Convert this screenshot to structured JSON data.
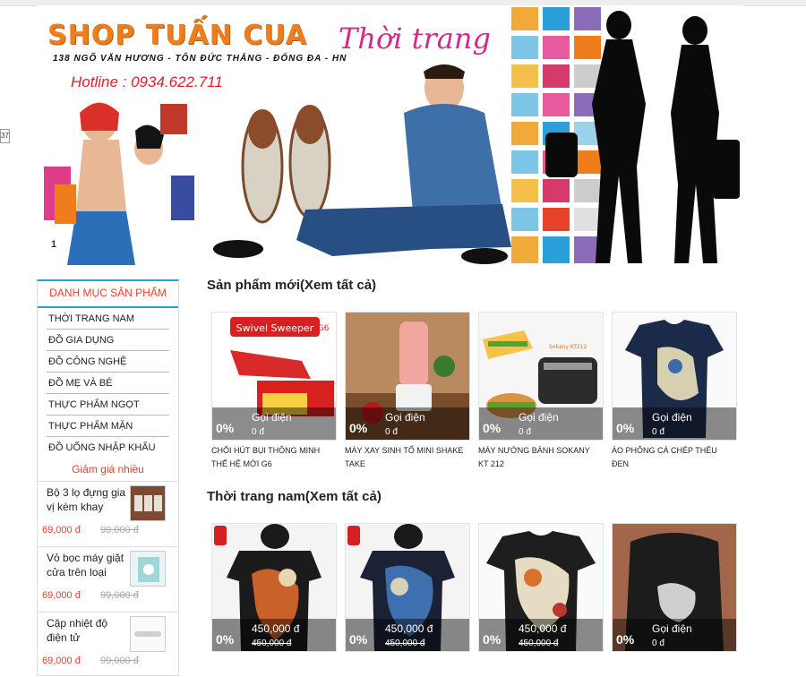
{
  "side_tag": "37",
  "banner": {
    "shop_name": "SHOP TUẤN CUA",
    "address": "138 NGÕ VĂN HƯƠNG - TÔN ĐỨC THẮNG - ĐỐNG ĐA - HN",
    "hotline": "Hotline : 0934.622.711",
    "script_text": "Thời trang",
    "slide_index": "1"
  },
  "sidebar": {
    "category_heading": "DANH MỤC SẢN PHẨM",
    "categories": [
      "THỜI TRANG NAM",
      "ĐỒ GIA DỤNG",
      "ĐỒ CÔNG NGHỆ",
      "ĐỒ MẸ VÀ BÉ",
      "THỰC PHẨM NGỌT",
      "THỰC PHẨM MẶN",
      "ĐỒ UỐNG NHẬP KHẨU"
    ],
    "promo_heading": "Giảm giá nhiều",
    "promos": [
      {
        "name": "Bộ 3 lọ đựng gia vị kèm khay",
        "price": "69,000 đ",
        "old_price": "99,000 đ"
      },
      {
        "name": "Vỏ bọc máy giặt cửa trên loại",
        "price": "69,000 đ",
        "old_price": "99,000 đ"
      },
      {
        "name": "Cặp nhiệt độ điện tử",
        "price": "69,000 đ",
        "old_price": "99,000 đ"
      }
    ]
  },
  "sections": [
    {
      "title": "Sản phẩm mới(Xem tất cả)",
      "products": [
        {
          "name": "CHỔI HÚT BỤI THÔNG MINH THẾ HỆ MỚI G6",
          "discount": "0%",
          "price": "Gọi điện",
          "old_price": "0 đ"
        },
        {
          "name": "MÁY XAY SINH TỐ MINI SHAKE TAKE",
          "discount": "0%",
          "price": "Gọi điện",
          "old_price": "0 đ"
        },
        {
          "name": "MÁY NƯỚNG BÁNH SOKANY KT 212",
          "discount": "0%",
          "price": "Gọi điện",
          "old_price": "0 đ"
        },
        {
          "name": "ÁO PHÔNG CÁ CHÉP THÊU ĐEN",
          "discount": "0%",
          "price": "Gọi điện",
          "old_price": "0 đ"
        }
      ]
    },
    {
      "title": "Thời trang nam(Xem tất cả)",
      "products": [
        {
          "discount": "0%",
          "price": "450,000 đ",
          "old_price": "450,000 đ"
        },
        {
          "discount": "0%",
          "price": "450,000 đ",
          "old_price": "450,000 đ"
        },
        {
          "discount": "0%",
          "price": "450,000 đ",
          "old_price": "450,000 đ"
        },
        {
          "discount": "0%",
          "price": "Gọi điện",
          "old_price": "0 đ"
        }
      ]
    }
  ],
  "image_labels": {
    "sweeper_brand": "Swivel Sweeper",
    "sweeper_model": "G6",
    "toaster_brand": "Sokany KT212"
  },
  "colors": {
    "accent": "#2a9fd8",
    "brand_orange": "#f07d1c",
    "price_red": "#e8412c"
  }
}
